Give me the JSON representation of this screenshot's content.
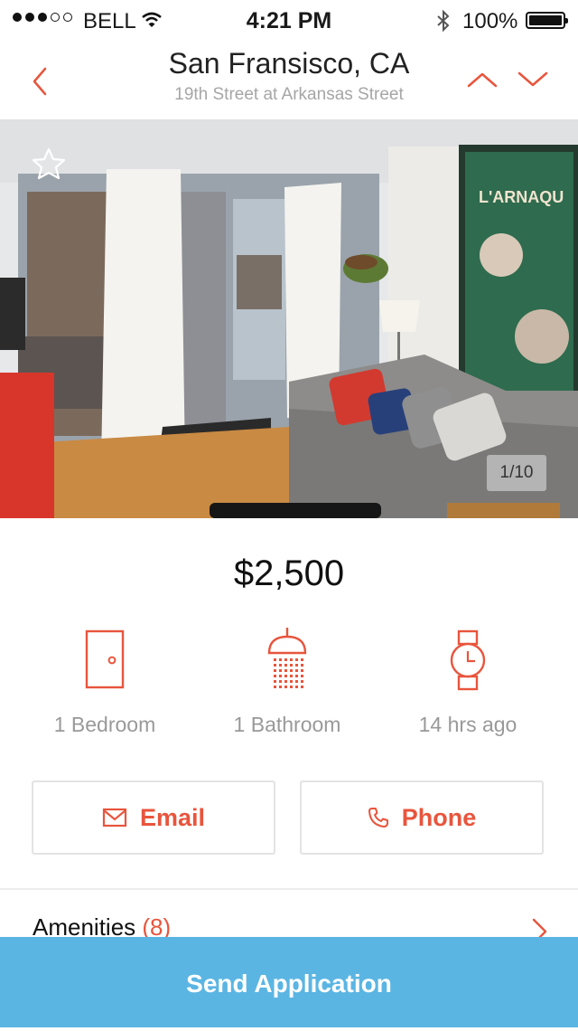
{
  "status_bar": {
    "carrier": "BELL",
    "time": "4:21 PM",
    "battery": "100%",
    "signal_bars": 3,
    "signal_total": 5
  },
  "nav": {
    "title": "San Fransisco, CA",
    "subtitle": "19th Street at Arkansas Street",
    "back_icon": "chevron-left-icon",
    "prev_icon": "chevron-up-icon",
    "next_icon": "chevron-down-icon"
  },
  "photo": {
    "counter": "1/10",
    "favorite_icon": "star-outline-icon"
  },
  "listing": {
    "price": "$2,500",
    "features": [
      {
        "icon": "door-icon",
        "label": "1 Bedroom"
      },
      {
        "icon": "shower-icon",
        "label": "1 Bathroom"
      },
      {
        "icon": "watch-icon",
        "label": "14 hrs ago"
      }
    ]
  },
  "contact": {
    "email_label": "Email",
    "phone_label": "Phone"
  },
  "amenities": {
    "label": "Amenities",
    "count": "(8)"
  },
  "cta": {
    "label": "Send Application"
  },
  "colors": {
    "accent": "#e8553d",
    "cta_bg": "#5bb5e3",
    "muted_text": "#999999"
  }
}
